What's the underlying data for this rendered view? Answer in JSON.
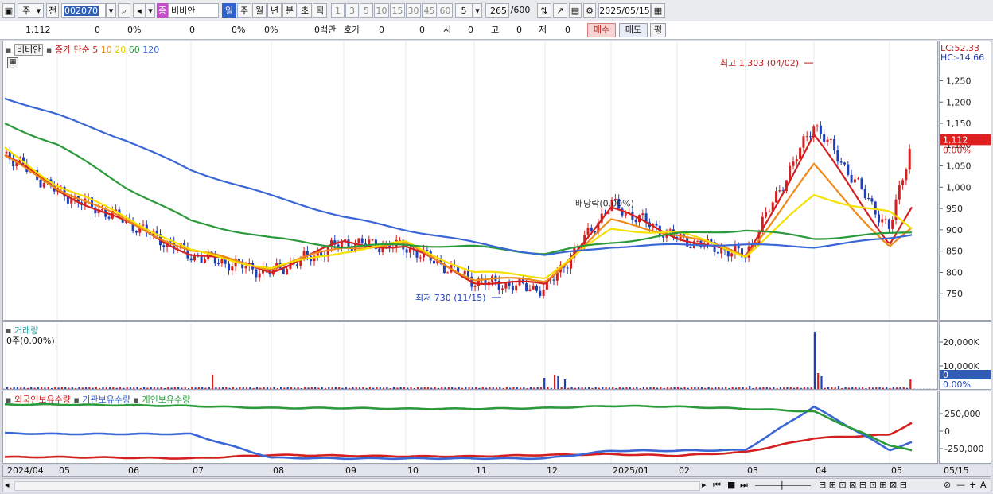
{
  "toolbar": {
    "period_main": "주",
    "prefix": "전",
    "code": "002070",
    "name_tag": "종",
    "name": "비비안",
    "periods": [
      "일",
      "주",
      "월",
      "년",
      "분",
      "초",
      "틱"
    ],
    "active_period": "일",
    "intervals": [
      "1",
      "3",
      "5",
      "10",
      "15",
      "30",
      "45",
      "60"
    ],
    "interval_value": "5",
    "count": "265",
    "count_max": "/600",
    "date": "2025/05/15"
  },
  "info": {
    "price": "1,112",
    "change": "0",
    "change_pct": "0%",
    "volume": "0",
    "volume_pct": "0%",
    "pct2": "0%",
    "amount": "0백만",
    "ask_label": "호가",
    "ask1": "0",
    "ask2": "0",
    "open_label": "시",
    "open": "0",
    "high_label": "고",
    "high": "0",
    "low_label": "저",
    "low": "0",
    "buy_label": "매수",
    "sell_label": "매도",
    "eval_label": "평"
  },
  "price_pane": {
    "legend_name": "비비안",
    "legend_type": "종가 단순",
    "ma_periods": [
      "5",
      "10",
      "20",
      "60",
      "120"
    ],
    "ma_colors": [
      "#d42020",
      "#f08a1a",
      "#f5e000",
      "#2a9a3a",
      "#3a66d6"
    ],
    "lc": "LC:52.33",
    "hc": "HC:-14.66",
    "y_ticks": [
      "1,250",
      "1,200",
      "1,150",
      "1,100",
      "1,050",
      "1,000",
      "950",
      "900",
      "850",
      "800",
      "750"
    ],
    "last_price": "1,112",
    "last_pct": "0.00%",
    "high_note": "최고 1,303 (04/02)",
    "low_note": "최저 730 (11/15)",
    "dividend_note": "배당락(0.00%)"
  },
  "volume_pane": {
    "title": "거래량",
    "current": "0주(0.00%)",
    "y_ticks": [
      "20,000K",
      "10,000K"
    ],
    "last_value": "0",
    "last_pct": "0.00%"
  },
  "holding_pane": {
    "series": [
      "외국인보유수량",
      "기관보유수량",
      "개인보유수량"
    ],
    "colors": [
      "#d42020",
      "#3a66d6",
      "#2a9a3a"
    ],
    "y_ticks": [
      "250,000",
      "0",
      "-250,000"
    ]
  },
  "x_axis": {
    "labels": [
      "2024/04",
      "05",
      "06",
      "07",
      "08",
      "09",
      "10",
      "11",
      "12",
      "2025/01",
      "02",
      "03",
      "04",
      "05"
    ],
    "end_label": "05/15"
  },
  "chart_data": {
    "type": "candlestick",
    "series": [
      {
        "name": "종가",
        "x": [
          "2024/04",
          "05",
          "06",
          "07",
          "08",
          "09",
          "10",
          "11",
          "12",
          "2025/01",
          "02",
          "03",
          "04",
          "05",
          "05/15"
        ],
        "values": [
          1080,
          990,
          920,
          840,
          800,
          870,
          860,
          780,
          760,
          960,
          880,
          840,
          1150,
          900,
          1112
        ]
      },
      {
        "name": "5",
        "values": [
          1075,
          995,
          915,
          845,
          805,
          870,
          860,
          780,
          770,
          950,
          885,
          835,
          1120,
          870,
          950
        ]
      },
      {
        "name": "10",
        "values": [
          1070,
          1000,
          920,
          850,
          810,
          860,
          865,
          785,
          780,
          920,
          890,
          840,
          1050,
          860,
          900
        ]
      },
      {
        "name": "20",
        "values": [
          1090,
          1005,
          930,
          850,
          810,
          850,
          870,
          800,
          790,
          900,
          895,
          840,
          980,
          940,
          900
        ]
      },
      {
        "name": "60",
        "values": [
          1150,
          1100,
          1000,
          920,
          880,
          860,
          865,
          860,
          845,
          870,
          890,
          900,
          880,
          890,
          895
        ]
      },
      {
        "name": "120",
        "values": [
          1210,
          1170,
          1110,
          1040,
          980,
          930,
          900,
          870,
          840,
          860,
          865,
          865,
          860,
          880,
          890
        ]
      }
    ],
    "y_range": [
      700,
      1320
    ],
    "high": {
      "value": 1303,
      "date": "04/02"
    },
    "low": {
      "value": 730,
      "date": "11/15"
    },
    "volume": {
      "current": 0,
      "y_ticks": [
        "20,000K",
        "10,000K"
      ]
    },
    "holdings": {
      "series": [
        {
          "name": "외국인보유수량",
          "values": [
            -370000,
            -370000,
            -380000,
            -390000,
            -340000,
            -350000,
            -360000,
            -360000,
            -340000,
            -330000,
            -350000,
            -300000,
            -100000,
            -50000,
            120000
          ]
        },
        {
          "name": "기관보유수량",
          "values": [
            -30000,
            -40000,
            -40000,
            -40000,
            -380000,
            -390000,
            -390000,
            -390000,
            -390000,
            -280000,
            -280000,
            -270000,
            350000,
            -270000,
            -160000
          ]
        },
        {
          "name": "개인보유수량",
          "values": [
            380000,
            380000,
            370000,
            360000,
            330000,
            330000,
            320000,
            320000,
            330000,
            360000,
            350000,
            320000,
            280000,
            -200000,
            -280000
          ]
        }
      ]
    }
  }
}
